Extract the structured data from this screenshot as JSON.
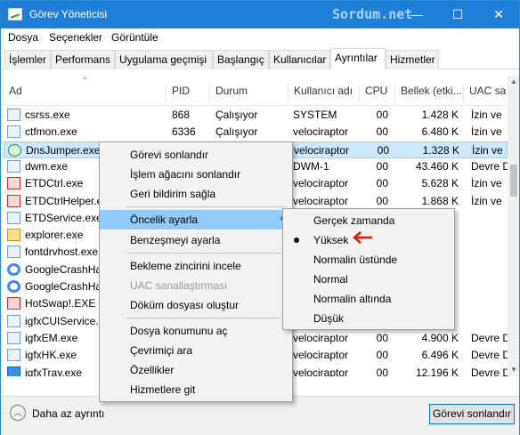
{
  "window": {
    "title": "Görev Yöneticisi",
    "watermark": "Sordum.net",
    "controls": {
      "minimize": "—",
      "maximize": "☐",
      "close": "✕"
    }
  },
  "menubar": {
    "items": [
      "Dosya",
      "Seçenekler",
      "Görüntüle"
    ]
  },
  "tabs": [
    {
      "label": "İşlemler"
    },
    {
      "label": "Performans"
    },
    {
      "label": "Uygulama geçmişi"
    },
    {
      "label": "Başlangıç"
    },
    {
      "label": "Kullanıcılar"
    },
    {
      "label": "Ayrıntılar"
    },
    {
      "label": "Hizmetler"
    }
  ],
  "active_tab": "Ayrıntılar",
  "table": {
    "headers": [
      "Ad",
      "PID",
      "Durum",
      "Kullanıcı adı",
      "CPU",
      "Bellek (etki...",
      "UAC sa"
    ],
    "rows": [
      {
        "name": "csrss.exe",
        "pid": "868",
        "status": "Çalışıyor",
        "user": "SYSTEM",
        "cpu": "00",
        "mem": "1.428 K",
        "uac": "İzin ve",
        "icon": "window-icon"
      },
      {
        "name": "ctfmon.exe",
        "pid": "6336",
        "status": "Çalışıyor",
        "user": "velociraptor",
        "cpu": "00",
        "mem": "6.480 K",
        "uac": "İzin ve",
        "icon": "pen-icon"
      },
      {
        "name": "DnsJumper.exe",
        "pid": "1152",
        "status": "Çalışıyor",
        "user": "velociraptor",
        "cpu": "00",
        "mem": "1.328 K",
        "uac": "İzin ve",
        "icon": "dns-jumper-icon"
      },
      {
        "name": "dwm.exe",
        "pid": "",
        "status": "",
        "user": "DWM-1",
        "cpu": "00",
        "mem": "43.460 K",
        "uac": "Devre D",
        "icon": "window-icon"
      },
      {
        "name": "ETDCtrl.exe",
        "pid": "",
        "status": "",
        "user": "velociraptor",
        "cpu": "00",
        "mem": "5.628 K",
        "uac": "İzin ve",
        "icon": "elan-icon"
      },
      {
        "name": "ETDCtrlHelper.exe",
        "pid": "",
        "status": "",
        "user": "velociraptor",
        "cpu": "00",
        "mem": "1.868 K",
        "uac": "İzin ve",
        "icon": "elan-icon"
      },
      {
        "name": "ETDService.exe",
        "pid": "",
        "status": "",
        "user": "",
        "cpu": "",
        "mem": "",
        "uac": "",
        "icon": "window-icon"
      },
      {
        "name": "explorer.exe",
        "pid": "",
        "status": "",
        "user": "",
        "cpu": "",
        "mem": "",
        "uac": "",
        "icon": "folder-icon"
      },
      {
        "name": "fontdrvhost.exe",
        "pid": "",
        "status": "",
        "user": "",
        "cpu": "",
        "mem": "",
        "uac": "",
        "icon": "window-icon"
      },
      {
        "name": "GoogleCrashHan",
        "pid": "",
        "status": "",
        "user": "",
        "cpu": "",
        "mem": "",
        "uac": "",
        "icon": "google-icon"
      },
      {
        "name": "GoogleCrashHan",
        "pid": "",
        "status": "",
        "user": "",
        "cpu": "",
        "mem": "",
        "uac": "",
        "icon": "google-icon"
      },
      {
        "name": "HotSwap!.EXE",
        "pid": "",
        "status": "",
        "user": "",
        "cpu": "",
        "mem": "",
        "uac": "",
        "icon": "hotswap-icon"
      },
      {
        "name": "igfxCUIService.e",
        "pid": "",
        "status": "",
        "user": "",
        "cpu": "",
        "mem": "",
        "uac": "",
        "icon": "window-icon"
      },
      {
        "name": "igfxEM.exe",
        "pid": "",
        "status": "",
        "user": "velociraptor",
        "cpu": "00",
        "mem": "4.900 K",
        "uac": "Devre D",
        "icon": "window-icon"
      },
      {
        "name": "igfxHK.exe",
        "pid": "",
        "status": "",
        "user": "velociraptor",
        "cpu": "00",
        "mem": "6.496 K",
        "uac": "Devre D",
        "icon": "window-icon"
      },
      {
        "name": "igfxTray.exe",
        "pid": "",
        "status": "",
        "user": "velociraptor",
        "cpu": "00",
        "mem": "12.196 K",
        "uac": "Devre D",
        "icon": "intel-icon"
      }
    ]
  },
  "context_menu": {
    "items": [
      "Görevi sonlandır",
      "İşlem ağacını sonlandır",
      "Geri bildirim sağla",
      "Öncelik ayarla",
      "Benzeşmeyi ayarla",
      "Bekleme zincirini incele",
      "UAC sanallaştırması",
      "Döküm dosyası oluştur",
      "Dosya konumunu aç",
      "Çevrimiçi ara",
      "Özellikler",
      "Hizmetlere git"
    ],
    "highlighted": "Öncelik ayarla",
    "disabled": [
      "UAC sanallaştırması"
    ]
  },
  "priority_submenu": {
    "items": [
      "Gerçek zamanda",
      "Yüksek",
      "Normalin üstünde",
      "Normal",
      "Normalin altında",
      "Düşük"
    ],
    "selected": "Yüksek"
  },
  "footer": {
    "less_details": "Daha az ayrıntı",
    "end_task": "Görevi sonlandır"
  }
}
